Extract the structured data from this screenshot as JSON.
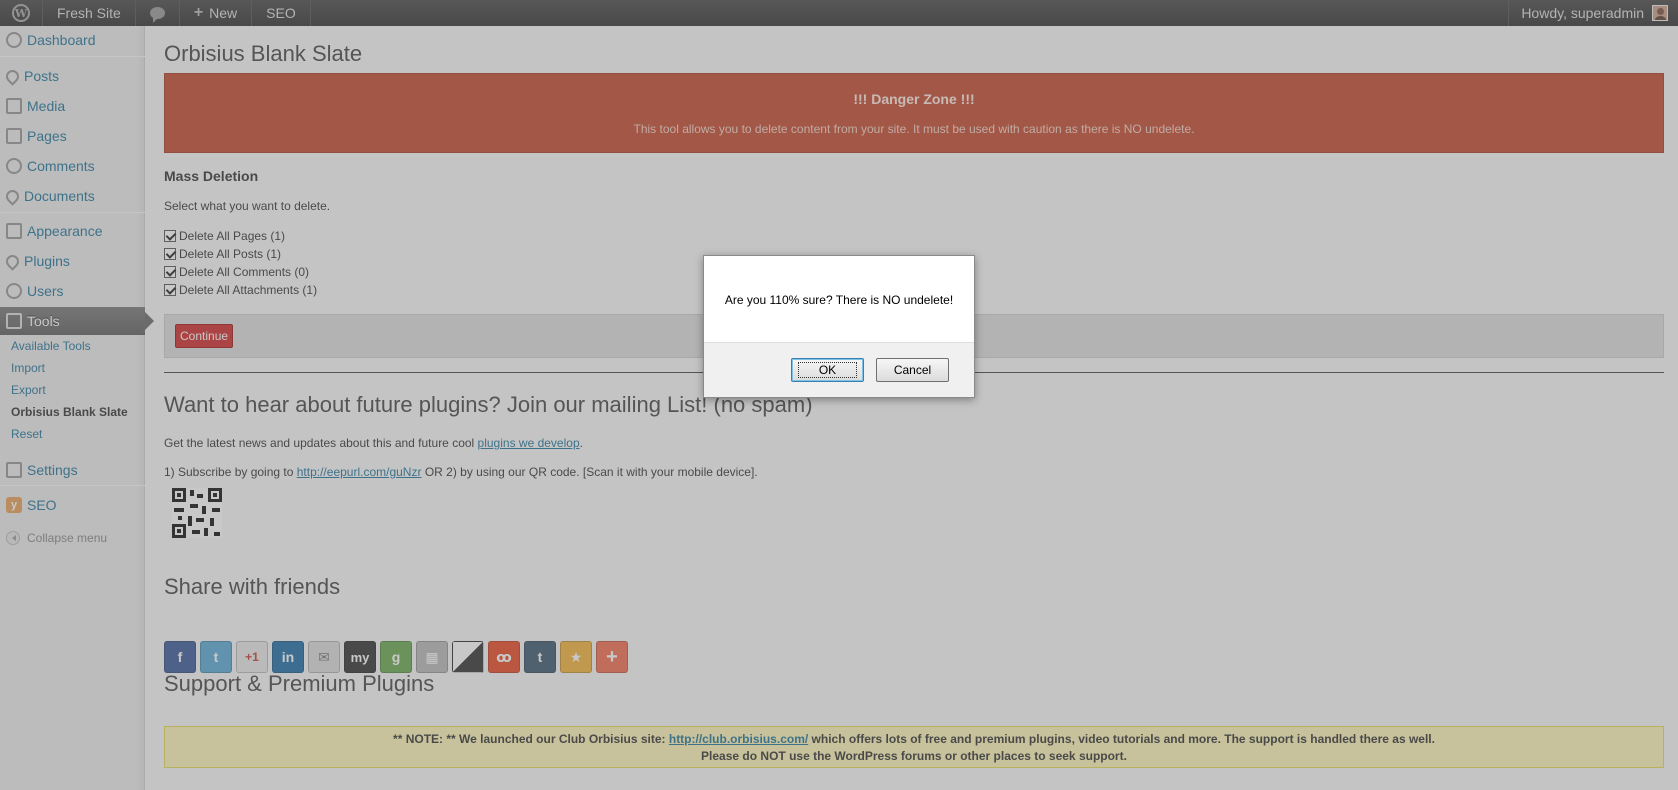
{
  "adminbar": {
    "site_name": "Fresh Site",
    "new_label": "New",
    "seo_label": "SEO",
    "howdy": "Howdy, superadmin"
  },
  "sidebar": {
    "items": {
      "dashboard": "Dashboard",
      "posts": "Posts",
      "media": "Media",
      "pages": "Pages",
      "comments": "Comments",
      "documents": "Documents",
      "appearance": "Appearance",
      "plugins": "Plugins",
      "users": "Users",
      "tools": "Tools",
      "settings": "Settings",
      "seo": "SEO",
      "collapse": "Collapse menu"
    },
    "tools_submenu": {
      "available": "Available Tools",
      "import": "Import",
      "export": "Export",
      "blank_slate": "Orbisius Blank Slate",
      "reset": "Reset"
    }
  },
  "main": {
    "title": "Orbisius Blank Slate",
    "danger": {
      "title": "!!! Danger Zone !!!",
      "text": "This tool allows you to delete content from your site. It must be used with caution as there is NO undelete."
    },
    "mass_deletion": {
      "heading": "Mass Deletion",
      "intro": "Select what you want to delete.",
      "options": {
        "pages": "Delete All Pages (1)",
        "posts": "Delete All Posts (1)",
        "comments": "Delete All Comments (0)",
        "attachments": "Delete All Attachments (1)"
      },
      "continue_label": "Continue"
    },
    "mailing": {
      "heading": "Want to hear about future plugins? Join our mailing List! (no spam)",
      "line1_prefix": "Get the latest news and updates about this and future cool ",
      "line1_link": "plugins we develop",
      "line1_suffix": ".",
      "line2_prefix": "1) Subscribe by going to ",
      "line2_link": "http://eepurl.com/guNzr",
      "line2_suffix": " OR 2) by using our QR code. [Scan it with your mobile device]."
    },
    "share": {
      "heading": "Share with friends",
      "icons": [
        "facebook-icon",
        "twitter-icon",
        "google-plus-icon",
        "linkedin-icon",
        "email-icon",
        "myspace-icon",
        "google-icon",
        "delicious-alt-icon",
        "delicious-icon",
        "stumbleupon-icon",
        "tumblr-icon",
        "favorites-icon",
        "more-icon"
      ],
      "google_plus_text": "+1",
      "linkedin_text": "in",
      "myspace_text": "my",
      "tumblr_text": "t",
      "more_text": "+"
    },
    "support": {
      "heading": "Support & Premium Plugins",
      "note_prefix": "** NOTE: ** We launched our Club Orbisius site: ",
      "note_link": "http://club.orbisius.com/",
      "note_suffix": " which offers lots of free and premium plugins, video tutorials and more. The support is handled there as well.",
      "note_line2": "Please do NOT use the WordPress forums or other places to seek support."
    }
  },
  "dialog": {
    "message": "Are you 110% sure? There is NO undelete!",
    "ok_label": "OK",
    "cancel_label": "Cancel"
  }
}
